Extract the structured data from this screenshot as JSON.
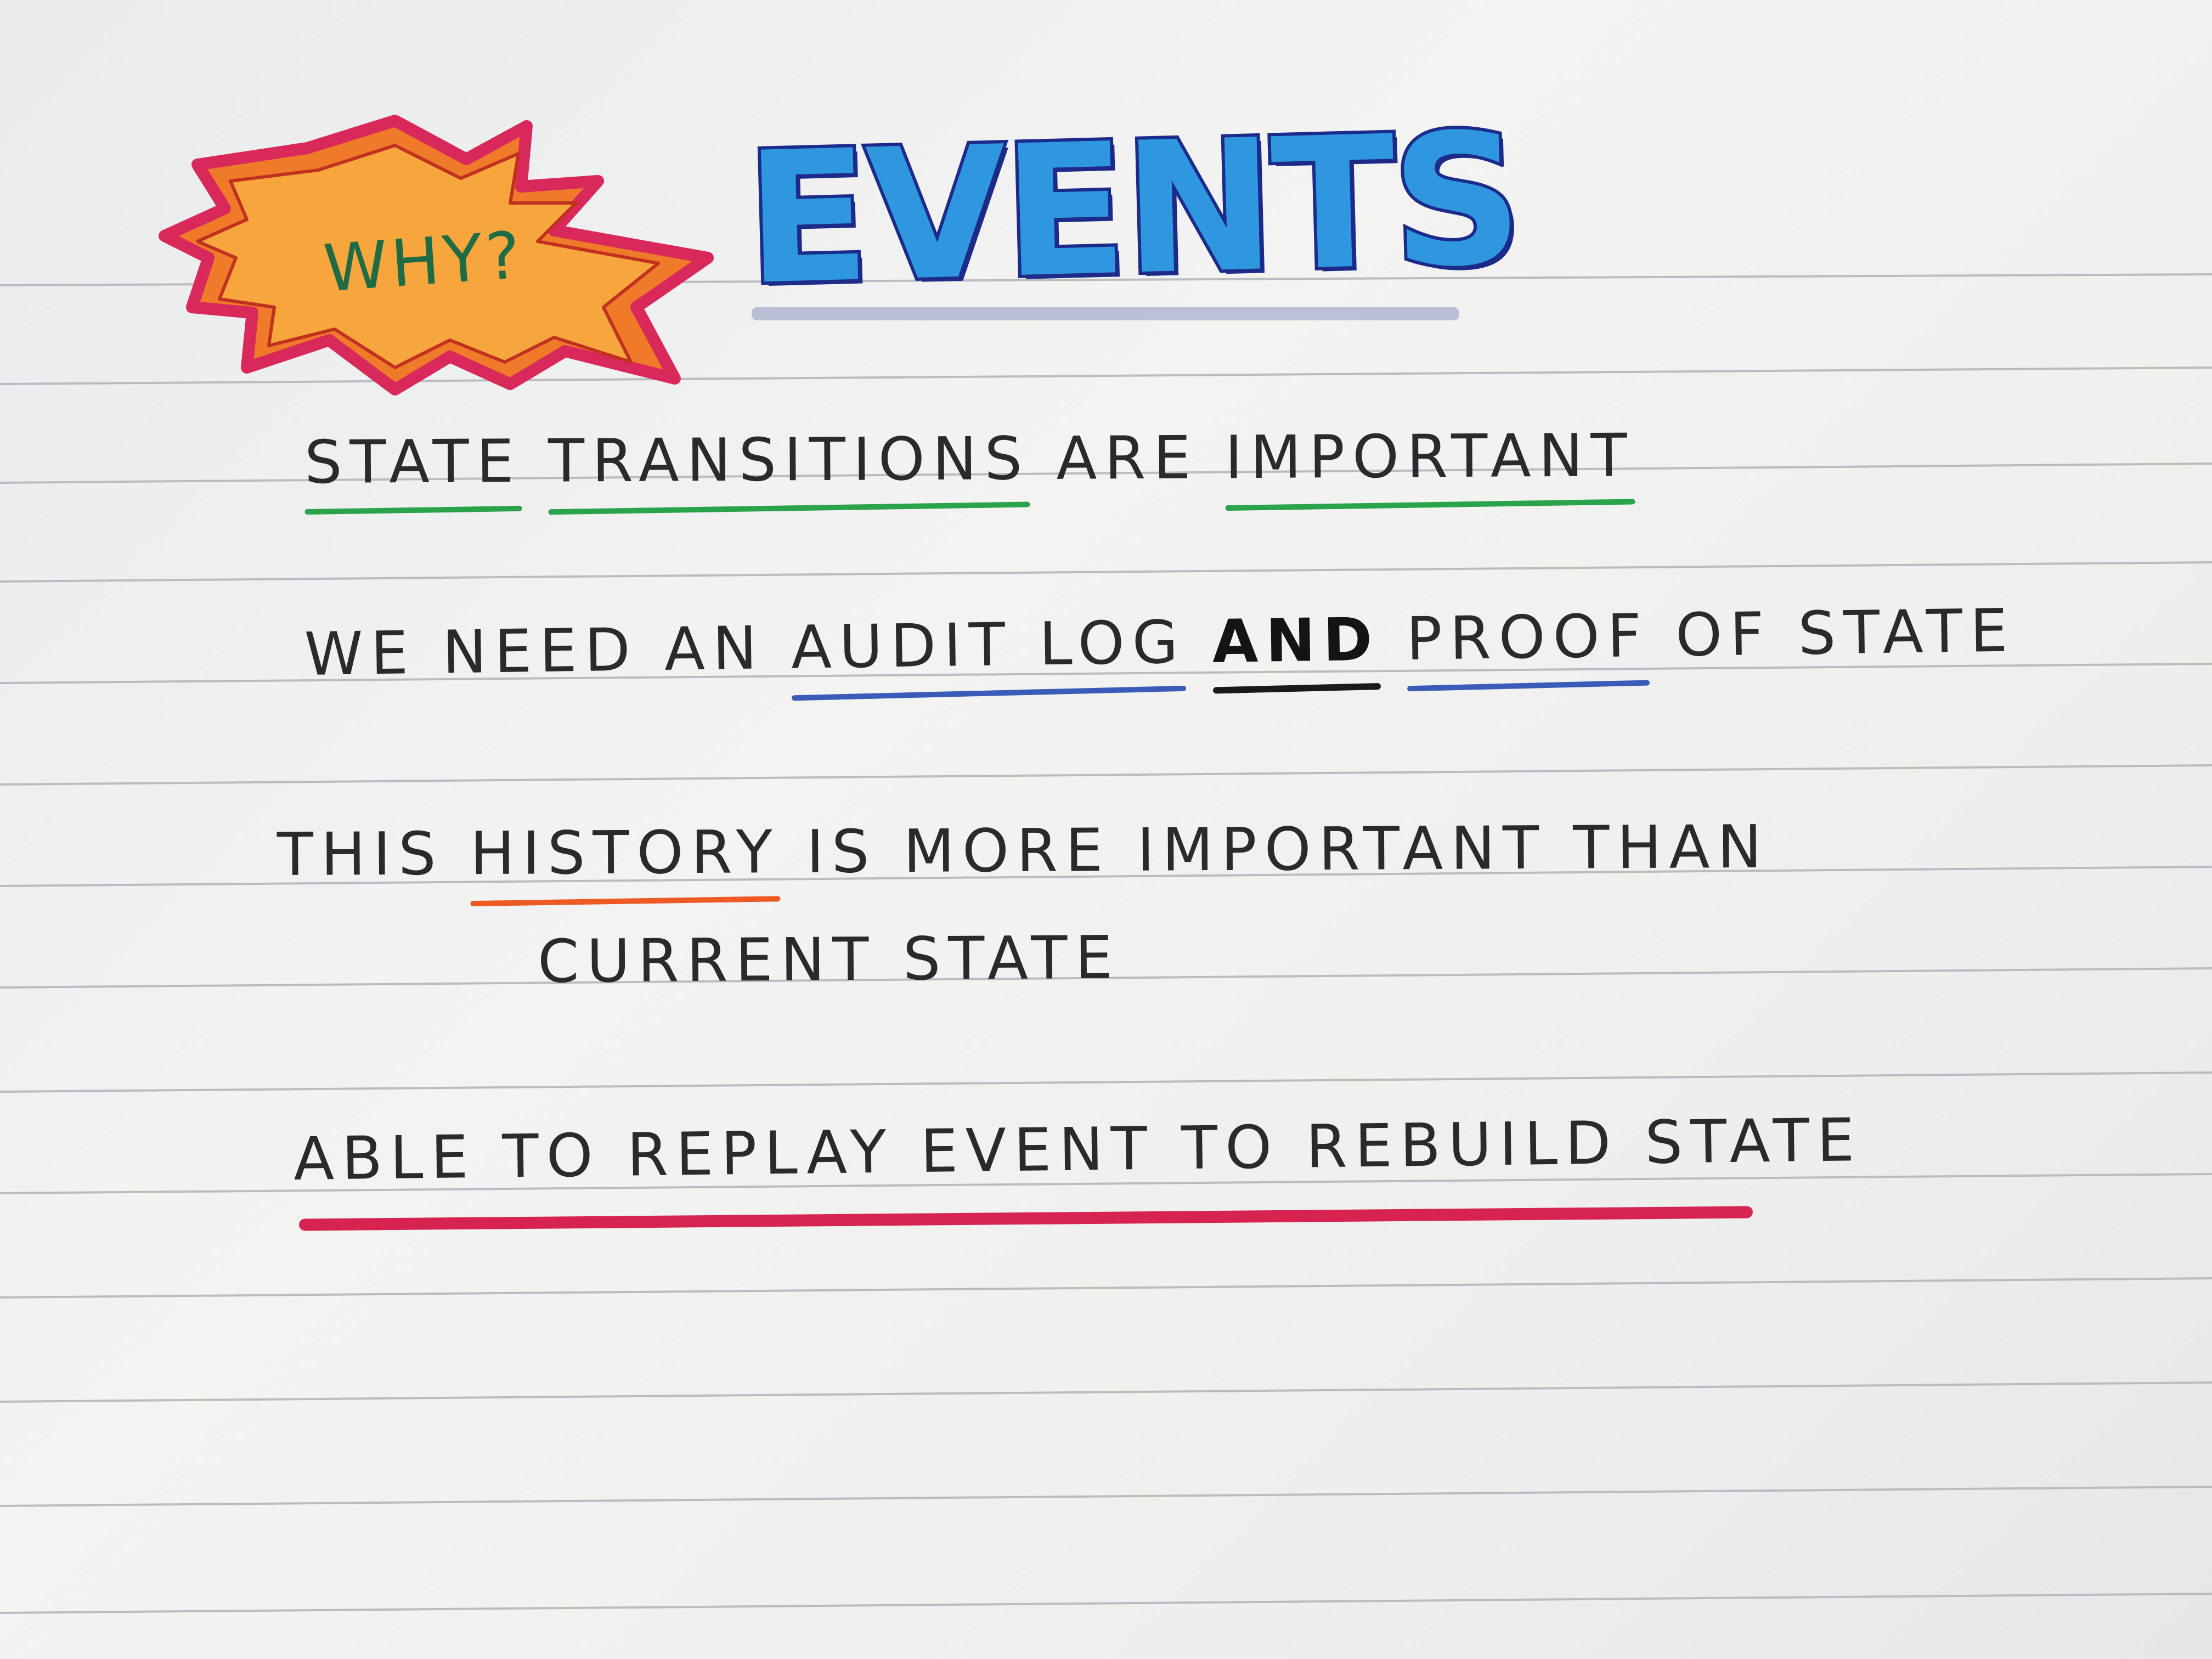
{
  "header": {
    "why_label": "WHY?",
    "events_label": "EVENTS"
  },
  "lines": {
    "l1": {
      "w1": "STATE",
      "w2": "TRANSITIONS",
      "w3": "ARE",
      "w4": "IMPORTANT"
    },
    "l2": {
      "w1": "WE NEED AN",
      "w2": "AUDIT LOG",
      "w3": "AND",
      "w4": "PROOF",
      "w5": "OF STATE"
    },
    "l3": {
      "w1": "THIS",
      "w2": "HISTORY",
      "w3": "IS MORE IMPORTANT THAN"
    },
    "l4": {
      "w1": "CURRENT STATE"
    },
    "l5": {
      "w1": "ABLE TO REPLAY EVENT TO REBUILD STATE"
    }
  },
  "colors": {
    "paper": "#f1f1f0",
    "rule_line": "#b9bcc0",
    "ink": "#2a2a2c",
    "why_burst_fill": "#f6a63c",
    "why_burst_outline": "#d9285a",
    "why_text": "#1e6b45",
    "events_fill": "#2f97e0",
    "events_outline": "#1c2b8a",
    "underline_green": "#2aa34b",
    "underline_blue": "#3a5bb8",
    "underline_orange": "#ee5a24",
    "underline_red": "#d6234f"
  }
}
